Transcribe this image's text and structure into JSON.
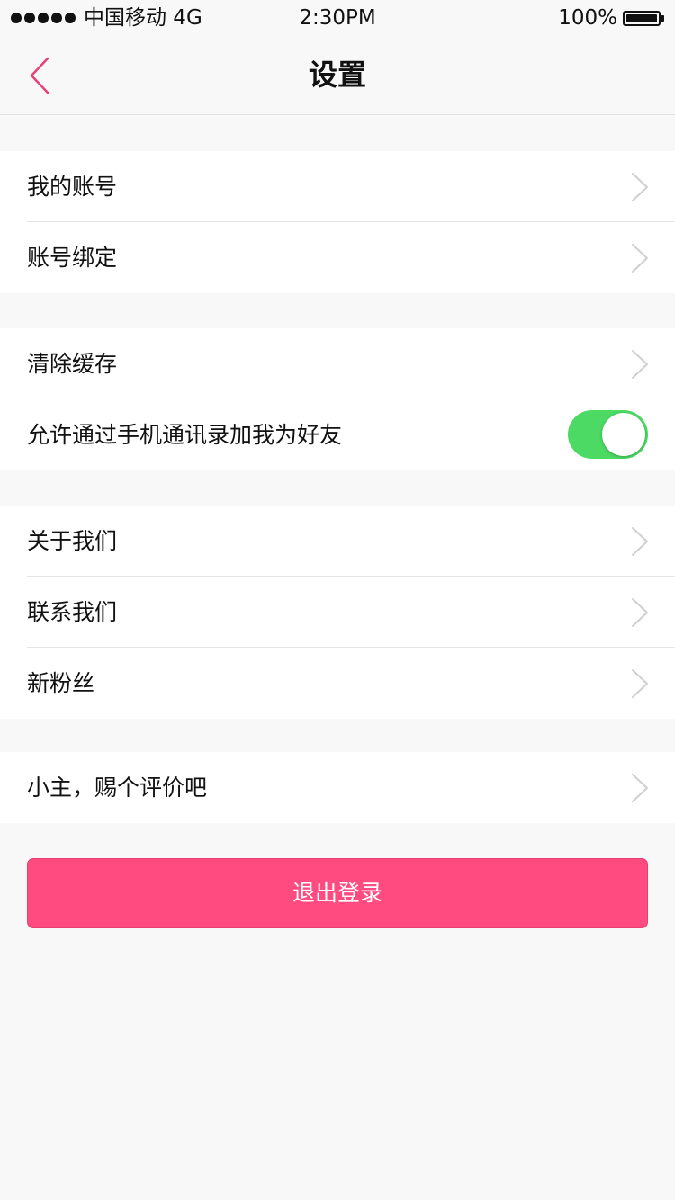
{
  "status_bar": {
    "carrier": "中国移动 4G",
    "time": "2:30PM",
    "battery": "100%",
    "battery_level": 1.0
  },
  "nav": {
    "title": "设置",
    "back_icon": "chevron-left-icon"
  },
  "groups": [
    {
      "rows": [
        {
          "label": "我的账号"
        },
        {
          "label": "账号绑定"
        }
      ]
    },
    {
      "rows": [
        {
          "label": "清除缓存"
        },
        {
          "label": "允许通过手机通讯录加我为好友",
          "toggle_on": true
        }
      ]
    },
    {
      "rows": [
        {
          "label": "关于我们"
        },
        {
          "label": "联系我们"
        },
        {
          "label": "新粉丝"
        }
      ]
    },
    {
      "rows": [
        {
          "label": "小主，赐个评价吧"
        }
      ]
    }
  ],
  "logout": {
    "label": "退出登录"
  },
  "colors": {
    "accent": "#ff4b80",
    "back_icon": "#e8407a",
    "toggle_on": "#4cd964",
    "background": "#f8f8f8",
    "chevron": "#cfcfcf"
  }
}
